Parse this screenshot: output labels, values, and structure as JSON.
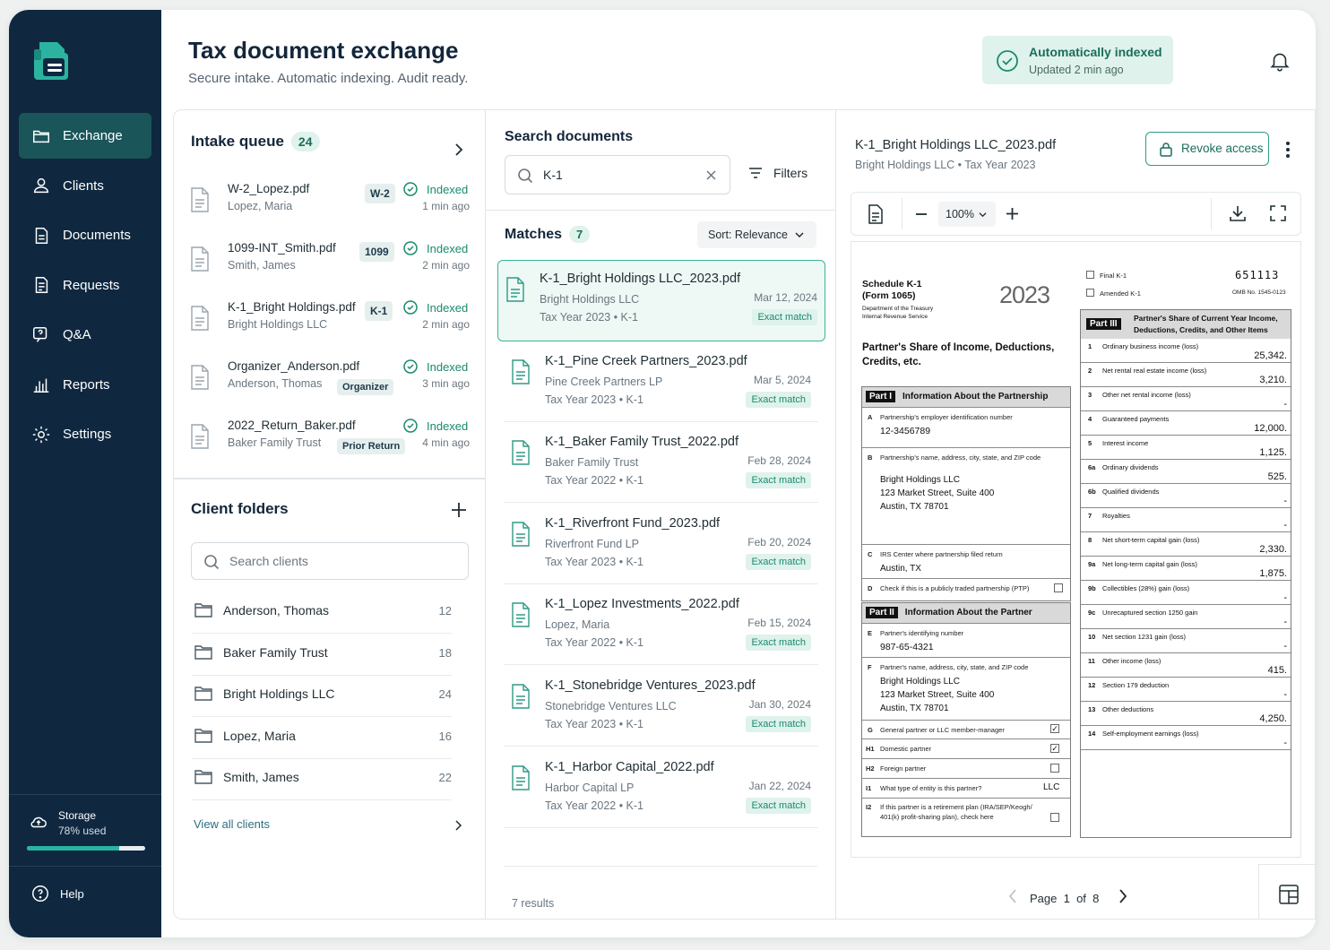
{
  "sidebar": {
    "items": [
      {
        "label": "Exchange",
        "icon": "folder-icon"
      },
      {
        "label": "Clients",
        "icon": "users-icon"
      },
      {
        "label": "Documents",
        "icon": "document-icon"
      },
      {
        "label": "Requests",
        "icon": "request-icon"
      },
      {
        "label": "Q&A",
        "icon": "chat-question-icon"
      },
      {
        "label": "Reports",
        "icon": "bar-chart-icon"
      },
      {
        "label": "Settings",
        "icon": "gear-icon"
      }
    ],
    "storage_label": "Storage",
    "storage_used": "78% used",
    "storage_fraction": 0.78,
    "help": "Help"
  },
  "header": {
    "title": "Tax document exchange",
    "subtitle": "Secure intake. Automatic indexing. Audit ready.",
    "status_title": "Automatically indexed",
    "status_sub": "Updated 2 min ago"
  },
  "intake": {
    "title": "Intake queue",
    "count": "24",
    "items": [
      {
        "name": "W-2_Lopez.pdf",
        "client": "Lopez, Maria",
        "tag": "W-2",
        "status": "Indexed",
        "time": "1 min ago"
      },
      {
        "name": "1099-INT_Smith.pdf",
        "client": "Smith, James",
        "tag": "1099",
        "status": "Indexed",
        "time": "2 min ago"
      },
      {
        "name": "K-1_Bright Holdings.pdf",
        "client": "Bright Holdings LLC",
        "tag": "K-1",
        "status": "Indexed",
        "time": "2 min ago"
      },
      {
        "name": "Organizer_Anderson.pdf",
        "client": "Anderson, Thomas",
        "tag": "Organizer",
        "status": "Indexed",
        "time": "3 min ago"
      },
      {
        "name": "2022_Return_Baker.pdf",
        "client": "Baker Family Trust",
        "tag": "Prior Return",
        "status": "Indexed",
        "time": "4 min ago"
      }
    ]
  },
  "folders": {
    "title": "Client folders",
    "search_placeholder": "Search clients",
    "items": [
      {
        "name": "Anderson, Thomas",
        "count": "12"
      },
      {
        "name": "Baker Family Trust",
        "count": "18"
      },
      {
        "name": "Bright Holdings LLC",
        "count": "24"
      },
      {
        "name": "Lopez, Maria",
        "count": "16"
      },
      {
        "name": "Smith, James",
        "count": "22"
      }
    ],
    "view_all": "View all clients"
  },
  "search": {
    "title": "Search documents",
    "query": "K-1",
    "filters": "Filters",
    "matches_label": "Matches",
    "matches_count": "7",
    "sort": "Sort: Relevance",
    "results": "7 results",
    "items": [
      {
        "name": "K-1_Bright Holdings LLC_2023.pdf",
        "client": "Bright Holdings LLC",
        "meta": "Tax Year 2023  •  K-1",
        "date": "Mar 12, 2024",
        "match": "Exact match"
      },
      {
        "name": "K-1_Pine Creek Partners_2023.pdf",
        "client": "Pine Creek Partners LP",
        "meta": "Tax Year 2023  •  K-1",
        "date": "Mar 5, 2024",
        "match": "Exact match"
      },
      {
        "name": "K-1_Baker Family Trust_2022.pdf",
        "client": "Baker Family Trust",
        "meta": "Tax Year 2022  •  K-1",
        "date": "Feb 28, 2024",
        "match": "Exact match"
      },
      {
        "name": "K-1_Riverfront Fund_2023.pdf",
        "client": "Riverfront Fund LP",
        "meta": "Tax Year 2023  •  K-1",
        "date": "Feb 20, 2024",
        "match": "Exact match"
      },
      {
        "name": "K-1_Lopez Investments_2022.pdf",
        "client": "Lopez, Maria",
        "meta": "Tax Year 2022  •  K-1",
        "date": "Feb 15, 2024",
        "match": "Exact match"
      },
      {
        "name": "K-1_Stonebridge Ventures_2023.pdf",
        "client": "Stonebridge Ventures LLC",
        "meta": "Tax Year 2023  •  K-1",
        "date": "Jan 30, 2024",
        "match": "Exact match"
      },
      {
        "name": "K-1_Harbor Capital_2022.pdf",
        "client": "Harbor Capital LP",
        "meta": "Tax Year 2022  •  K-1",
        "date": "Jan 22, 2024",
        "match": "Exact match"
      }
    ]
  },
  "viewer": {
    "file": "K-1_Bright Holdings LLC_2023.pdf",
    "meta": "Bright Holdings LLC  •  Tax Year 2023",
    "revoke": "Revoke access",
    "zoom": "100%",
    "page_label": "Page",
    "page": "1",
    "of": "of",
    "total": "8"
  },
  "form": {
    "schedule": "Schedule K-1",
    "form_no": "(Form 1065)",
    "dept1": "Department of the Treasury",
    "dept2": "Internal Revenue Service",
    "year": "2023",
    "heading": "Partner's Share of Income, Deductions, Credits, etc.",
    "final": "Final K-1",
    "amended": "Amended K-1",
    "code": "651113",
    "omb": "OMB No. 1545-0123",
    "part1": "Part I",
    "part1_title": "Information About the Partnership",
    "a_label": "Partnership's employer identification number",
    "a_val": "12-3456789",
    "a_letter": "A",
    "b_letter": "B",
    "c_letter": "C",
    "d_letter": "D",
    "b_label": "Partnership's name, address, city, state, and ZIP code",
    "b_l1": "Bright Holdings LLC",
    "b_l2": "123 Market Street, Suite 400",
    "b_l3": "Austin, TX 78701",
    "c_label": "IRS Center where partnership filed return",
    "c_val": "Austin, TX",
    "d_label": "Check if this is a publicly traded partnership (PTP)",
    "part2": "Part II",
    "part2_title": "Information About the Partner",
    "e_letter": "E",
    "f_letter": "F",
    "g_letter": "G",
    "h1_letter": "H1",
    "h2_letter": "H2",
    "i1_letter": "I1",
    "i2_letter": "I2",
    "e_label": "Partner's identifying number",
    "e_val": "987-65-4321",
    "f_label": "Partner's name, address, city, state, and ZIP code",
    "f_l1": "Bright Holdings LLC",
    "f_l2": "123 Market Street, Suite 400",
    "f_l3": "Austin, TX 78701",
    "g_label": "General partner or LLC member-manager",
    "h1_label": "Domestic partner",
    "h2_label": "Foreign partner",
    "i1_label": "What type of entity is this partner?",
    "i1_val": "LLC",
    "i2_label1": "If this partner is a retirement plan (IRA/SEP/Keogh/",
    "i2_label2": "401(k) profit-sharing plan), check here",
    "check": "✓",
    "part3": "Part III",
    "part3_title1": "Partner's Share of Current Year Income,",
    "part3_title2": "Deductions, Credits, and Other Items",
    "lines": [
      {
        "n": "1",
        "l": "Ordinary business income (loss)",
        "v": "25,342."
      },
      {
        "n": "2",
        "l": "Net rental real estate income (loss)",
        "v": "3,210."
      },
      {
        "n": "3",
        "l": "Other net rental income (loss)",
        "v": "-"
      },
      {
        "n": "4",
        "l": "Guaranteed payments",
        "v": "12,000."
      },
      {
        "n": "5",
        "l": "Interest income",
        "v": "1,125."
      },
      {
        "n": "6a",
        "l": "Ordinary dividends",
        "v": "525."
      },
      {
        "n": "6b",
        "l": "Qualified dividends",
        "v": "-"
      },
      {
        "n": "7",
        "l": "Royalties",
        "v": "-"
      },
      {
        "n": "8",
        "l": "Net short-term capital gain (loss)",
        "v": "2,330."
      },
      {
        "n": "9a",
        "l": "Net long-term capital gain (loss)",
        "v": "1,875."
      },
      {
        "n": "9b",
        "l": "Collectibles (28%) gain (loss)",
        "v": "-"
      },
      {
        "n": "9c",
        "l": "Unrecaptured section 1250 gain",
        "v": "-"
      },
      {
        "n": "10",
        "l": "Net section 1231 gain (loss)",
        "v": "-"
      },
      {
        "n": "11",
        "l": "Other income (loss)",
        "v": "415."
      },
      {
        "n": "12",
        "l": "Section 179 deduction",
        "v": "-"
      },
      {
        "n": "13",
        "l": "Other deductions",
        "v": "4,250."
      },
      {
        "n": "14",
        "l": "Self-employment earnings (loss)",
        "v": "-"
      }
    ]
  },
  "colors": {
    "sidebar": "#0f2840",
    "active": "#1a5559",
    "accent": "#1a8a6e",
    "badge_bg": "#dff2ec"
  }
}
